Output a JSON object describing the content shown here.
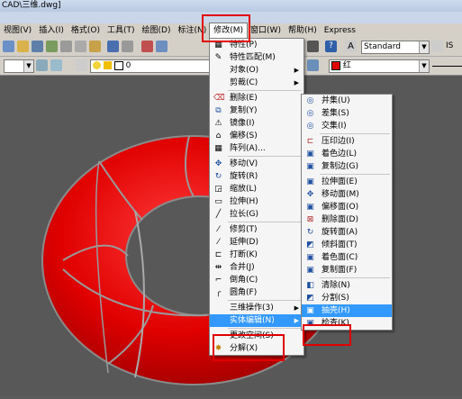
{
  "window": {
    "title": "CAD\\三维.dwg]"
  },
  "menubar": [
    {
      "label": "视图(V)"
    },
    {
      "label": "插入(I)"
    },
    {
      "label": "格式(O)"
    },
    {
      "label": "工具(T)"
    },
    {
      "label": "绘图(D)"
    },
    {
      "label": "标注(N)"
    },
    {
      "label": "修改(M)"
    },
    {
      "label": "窗口(W)"
    },
    {
      "label": "帮助(H)"
    },
    {
      "label": "Express"
    }
  ],
  "toolbar": {
    "text_style": "Standard",
    "iso_label": "IS",
    "layer_value": "0",
    "color_value": "红"
  },
  "modify_menu": {
    "items": [
      {
        "label": "特性(P)",
        "icon": "properties-icon"
      },
      {
        "label": "特性匹配(M)",
        "icon": "match-brush-icon"
      },
      {
        "label": "对象(O)",
        "submenu": true
      },
      {
        "label": "剪裁(C)",
        "submenu": true
      },
      {
        "label": "删除(E)",
        "icon": "eraser-icon"
      },
      {
        "label": "复制(Y)",
        "icon": "copy-icon"
      },
      {
        "label": "镜像(I)",
        "icon": "mirror-icon"
      },
      {
        "label": "偏移(S)",
        "icon": "offset-icon"
      },
      {
        "label": "阵列(A)...",
        "icon": "array-icon"
      },
      {
        "label": "移动(V)",
        "icon": "move-icon"
      },
      {
        "label": "旋转(R)",
        "icon": "rotate-icon"
      },
      {
        "label": "缩放(L)",
        "icon": "scale-icon"
      },
      {
        "label": "拉伸(H)",
        "icon": "stretch-icon"
      },
      {
        "label": "拉长(G)",
        "icon": "lengthen-icon"
      },
      {
        "label": "修剪(T)",
        "icon": "trim-icon"
      },
      {
        "label": "延伸(D)",
        "icon": "extend-icon"
      },
      {
        "label": "打断(K)",
        "icon": "break-icon"
      },
      {
        "label": "合并(J)",
        "icon": "join-icon"
      },
      {
        "label": "倒角(C)",
        "icon": "chamfer-icon"
      },
      {
        "label": "圆角(F)",
        "icon": "fillet-icon"
      },
      {
        "label": "三维操作(3)",
        "submenu": true
      },
      {
        "label": "实体编辑(N)",
        "submenu": true
      },
      {
        "label": "更改空间(S)"
      },
      {
        "label": "分解(X)",
        "icon": "explode-icon"
      }
    ]
  },
  "solid_edit_menu": {
    "items": [
      {
        "label": "并集(U)",
        "icon": "union-icon"
      },
      {
        "label": "差集(S)",
        "icon": "subtract-icon"
      },
      {
        "label": "交集(I)",
        "icon": "intersect-icon"
      },
      {
        "label": "压印边(I)",
        "icon": "imprint-icon"
      },
      {
        "label": "着色边(L)",
        "icon": "color-edge-icon"
      },
      {
        "label": "复制边(G)",
        "icon": "copy-edge-icon"
      },
      {
        "label": "拉伸面(E)",
        "icon": "extrude-face-icon"
      },
      {
        "label": "移动面(M)",
        "icon": "move-face-icon"
      },
      {
        "label": "偏移面(O)",
        "icon": "offset-face-icon"
      },
      {
        "label": "删除面(D)",
        "icon": "delete-face-icon"
      },
      {
        "label": "旋转面(A)",
        "icon": "rotate-face-icon"
      },
      {
        "label": "倾斜面(T)",
        "icon": "taper-face-icon"
      },
      {
        "label": "着色面(C)",
        "icon": "color-face-icon"
      },
      {
        "label": "复制面(F)",
        "icon": "copy-face-icon"
      },
      {
        "label": "清除(N)",
        "icon": "clean-icon"
      },
      {
        "label": "分割(S)",
        "icon": "separate-icon"
      },
      {
        "label": "抽壳(H)",
        "icon": "shell-icon"
      },
      {
        "label": "检查(K)",
        "icon": "check-icon"
      }
    ]
  },
  "colors": {
    "accent": "#3399ff",
    "highlight_box": "#e00000",
    "torus": "#e60000"
  }
}
